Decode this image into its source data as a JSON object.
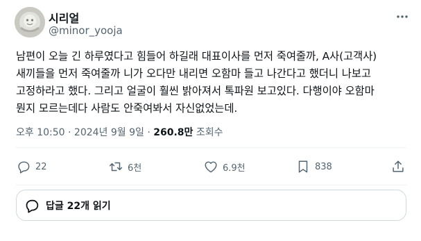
{
  "author": {
    "display_name": "시리얼",
    "handle": "@minor_yooja",
    "avatar_icon": "avatar-image"
  },
  "tweet": {
    "text": "남편이 오늘 긴 하루였다고 힘들어 하길래 대표이사를 먼저 죽여줄까, A사(고객사)\n새끼들을 먼저 죽여줄까 니가 오다만 내리면 오함마 들고 나간다고 했더니 나보고\n고정하라고 했다. 그리고 얼굴이 훨씬 밝아져서 톡파원 보고있다. 다행이야 오함마\n뭔지 모르는데다 사람도 안죽여봐서 자신없었는데.",
    "timestamp": "오후 10:50 · 2024년 9월 9일 · ",
    "views_count": "260.8만",
    "views_label": " 조회수"
  },
  "actions": {
    "replies": "22",
    "retweets": "6천",
    "likes": "6.9천",
    "bookmarks": "838",
    "icons": [
      "reply-icon",
      "retweet-icon",
      "heart-icon",
      "bookmark-icon",
      "share-icon"
    ]
  },
  "read_replies": {
    "label": "답글 22개 읽기",
    "icon": "speech-bubble-icon"
  },
  "colors": {
    "text": "#0f1419",
    "secondary": "#536471",
    "divider": "#eff3f4",
    "border": "#cfd9de"
  }
}
